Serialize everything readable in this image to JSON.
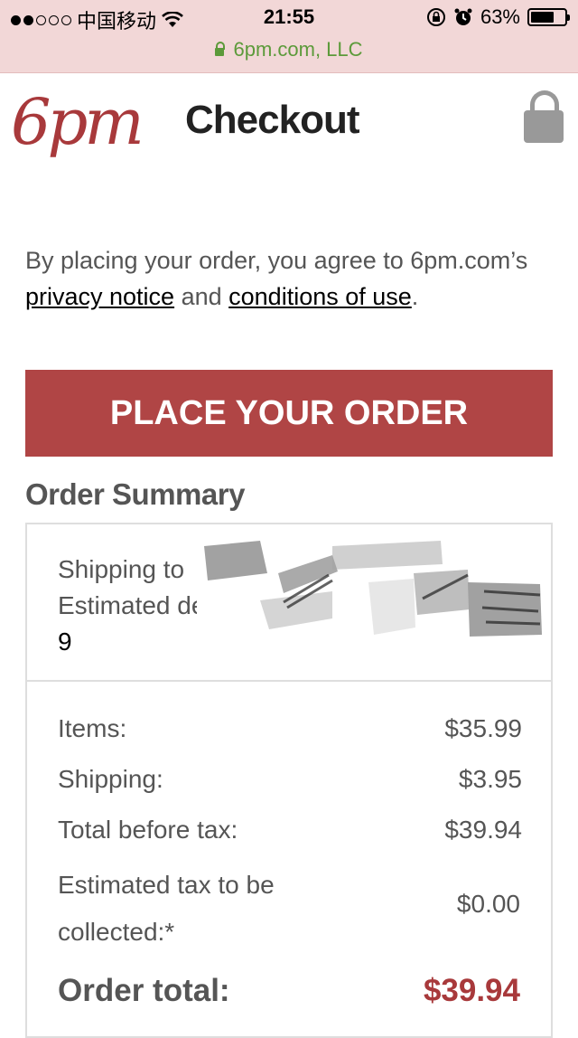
{
  "status_bar": {
    "carrier": "中国移动",
    "time": "21:55",
    "battery": "63%",
    "battery_level": 0.63,
    "url": "6pm.com, LLC"
  },
  "header": {
    "logo_text": "6pm",
    "title": "Checkout"
  },
  "agreement": {
    "prefix": "By placing your order, you agree to 6pm.com’s ",
    "privacy_link": "privacy notice",
    "middle": " and ",
    "conditions_link": "conditions of use",
    "suffix": "."
  },
  "place_order_label": "PLACE YOUR ORDER",
  "summary": {
    "title": "Order Summary",
    "shipping_to": "Shipping to",
    "estimated_delivery": "Estimated de",
    "delivery_day": "9",
    "items_label": "Items:",
    "items_value": "$35.99",
    "shipping_label": "Shipping:",
    "shipping_value": "$3.95",
    "before_tax_label": "Total before tax:",
    "before_tax_value": "$39.94",
    "tax_label": "Estimated tax to be collected:*",
    "tax_value": "$0.00",
    "total_label": "Order total:",
    "total_value": "$39.94"
  },
  "colors": {
    "brand": "#a8393b",
    "button": "#b04545",
    "status_bar_bg": "#f2d7d7",
    "url_green": "#5c9a3a"
  }
}
